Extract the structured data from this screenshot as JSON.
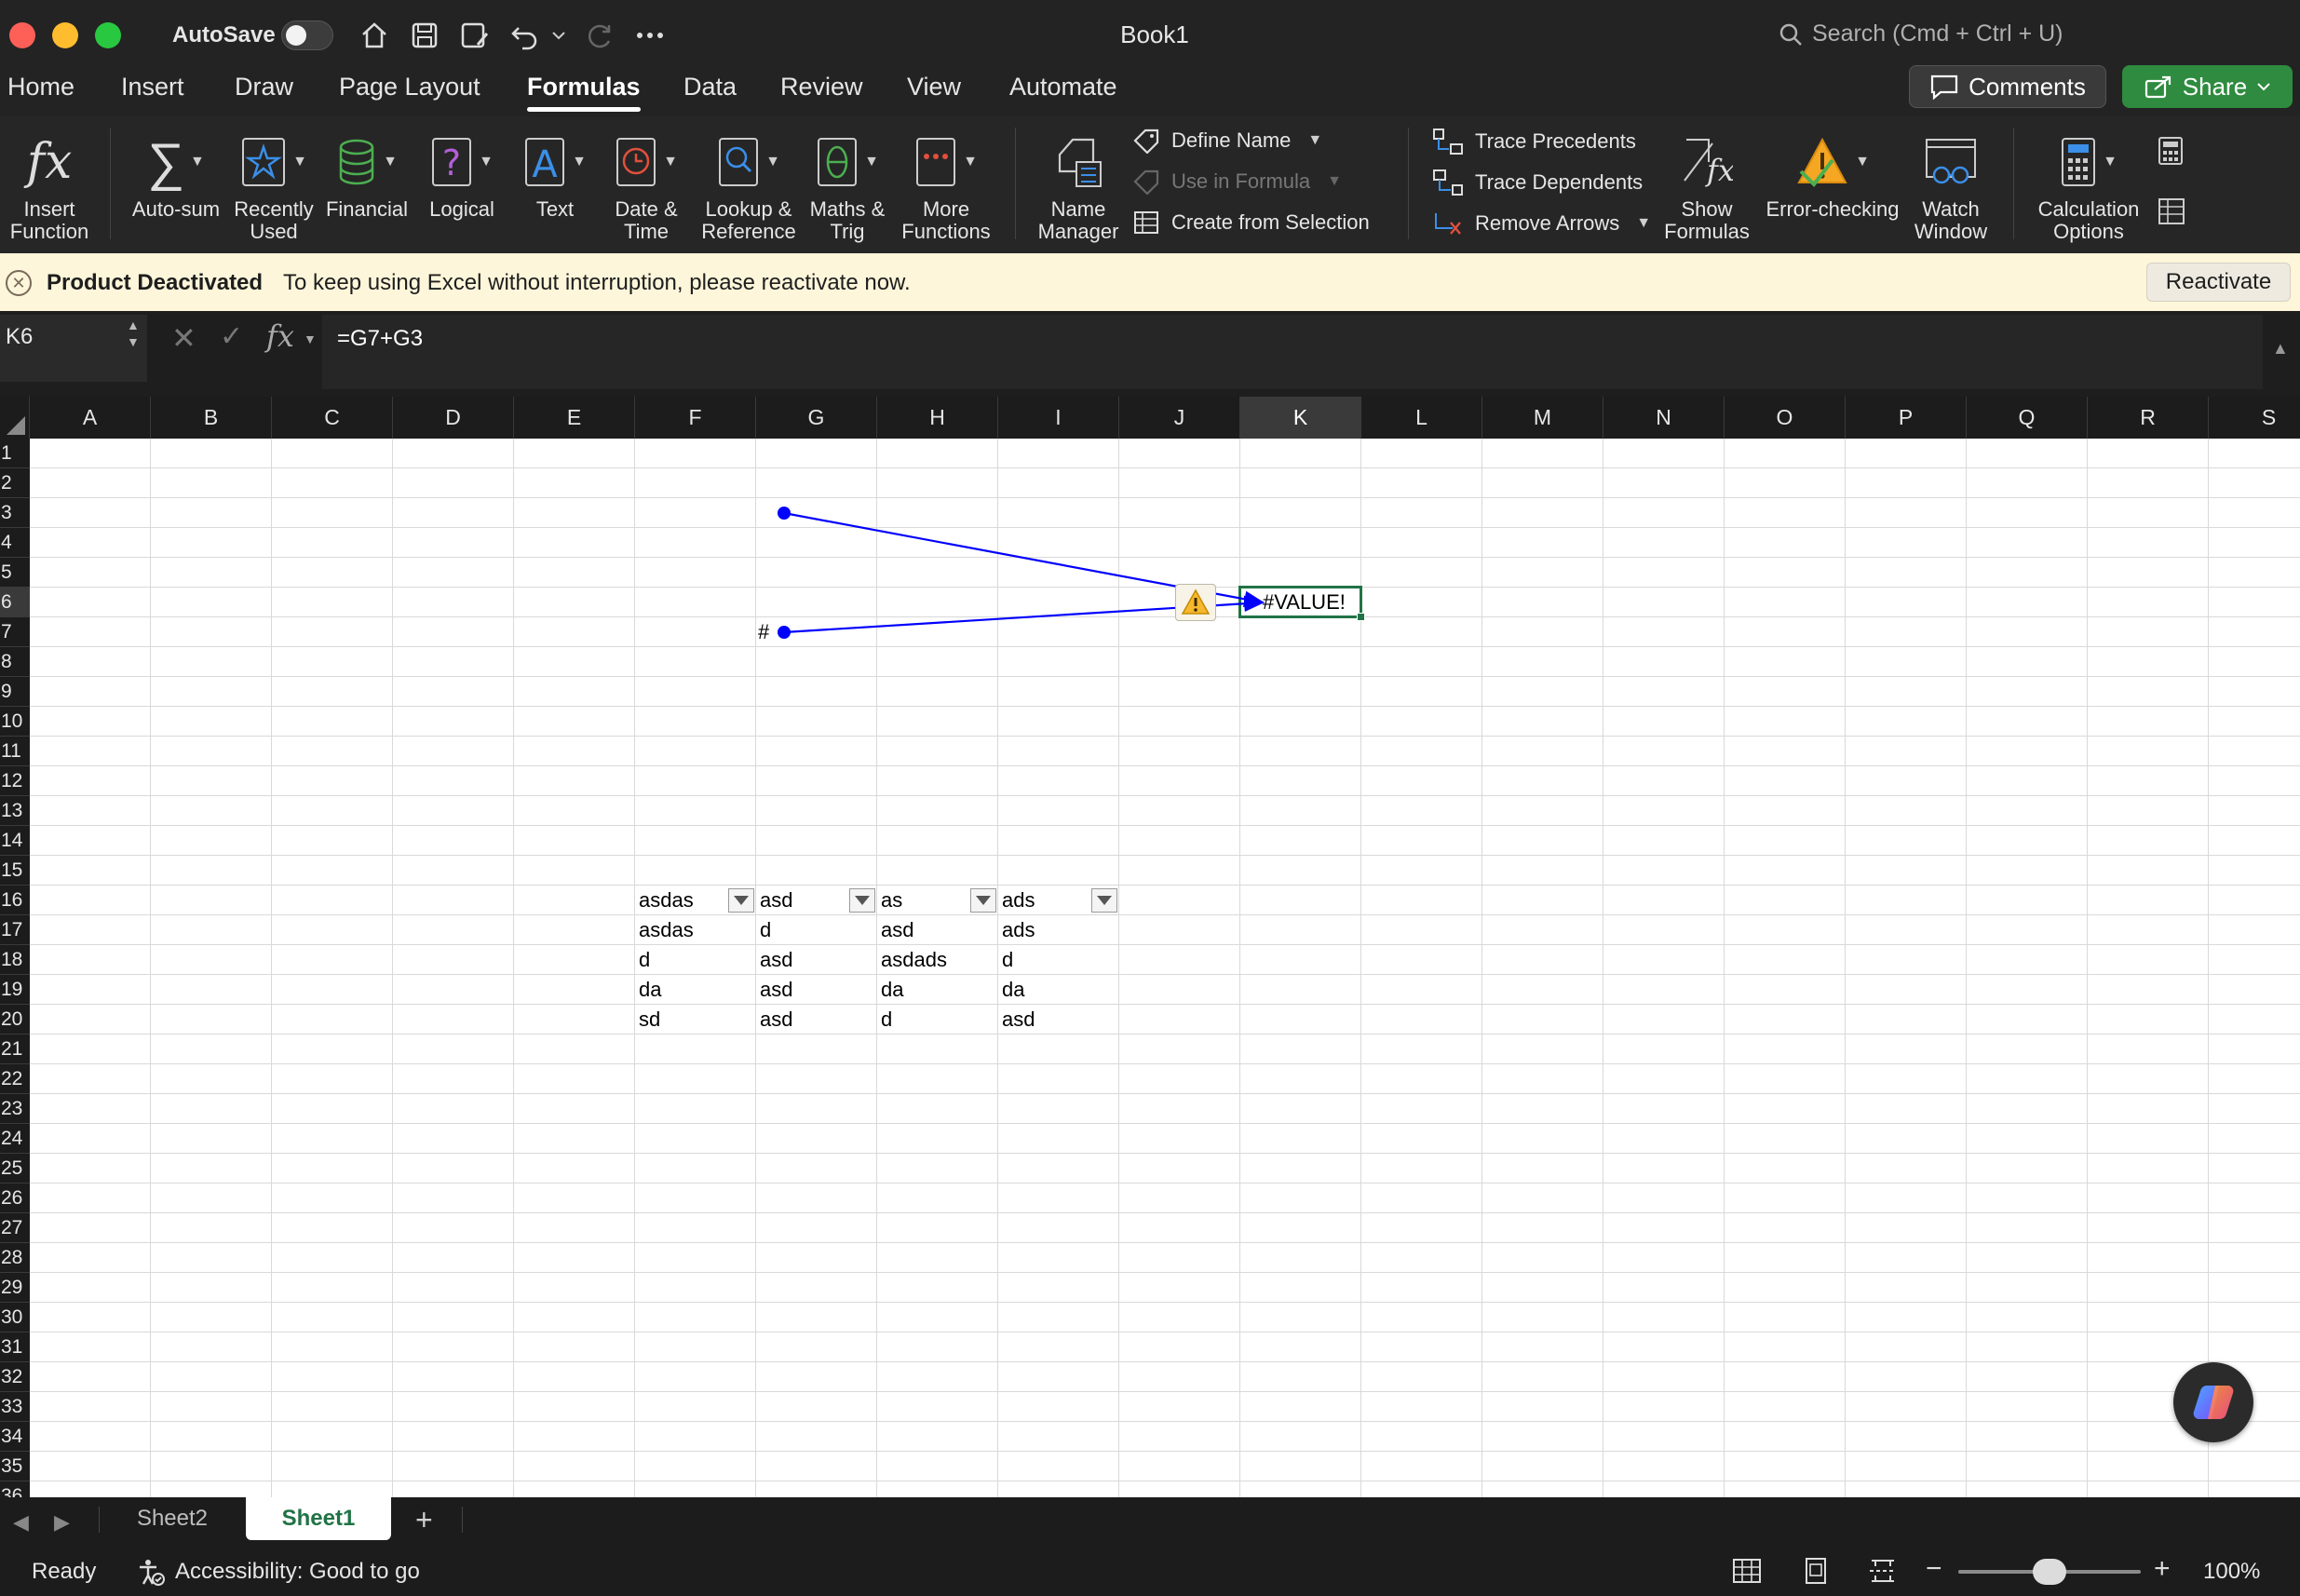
{
  "window": {
    "title": "Book1",
    "autosave_label": "AutoSave",
    "autosave_on": false,
    "search_placeholder": "Search (Cmd + Ctrl + U)"
  },
  "tabs": [
    {
      "label": "Home"
    },
    {
      "label": "Insert"
    },
    {
      "label": "Draw"
    },
    {
      "label": "Page Layout"
    },
    {
      "label": "Formulas",
      "active": true
    },
    {
      "label": "Data"
    },
    {
      "label": "Review"
    },
    {
      "label": "View"
    },
    {
      "label": "Automate"
    }
  ],
  "header_buttons": {
    "comments": "Comments",
    "share": "Share"
  },
  "ribbon": {
    "insert_function": [
      "Insert",
      "Function"
    ],
    "autosum": "Auto-sum",
    "recently_used": [
      "Recently",
      "Used"
    ],
    "financial": "Financial",
    "logical": "Logical",
    "text": "Text",
    "date_time": [
      "Date &",
      "Time"
    ],
    "lookup": [
      "Lookup &",
      "Reference"
    ],
    "maths": [
      "Maths &",
      "Trig"
    ],
    "more_functions": [
      "More",
      "Functions"
    ],
    "name_manager": [
      "Name",
      "Manager"
    ],
    "define_name": "Define Name",
    "use_in_formula": "Use in Formula",
    "create_from_selection": "Create from Selection",
    "trace_precedents": "Trace Precedents",
    "trace_dependents": "Trace Dependents",
    "remove_arrows": "Remove Arrows",
    "show_formulas": [
      "Show",
      "Formulas"
    ],
    "error_checking": "Error-checking",
    "watch_window": [
      "Watch",
      "Window"
    ],
    "calculation_options": [
      "Calculation",
      "Options"
    ]
  },
  "notification": {
    "title": "Product Deactivated",
    "message": "To keep using Excel without interruption, please reactivate now.",
    "button": "Reactivate"
  },
  "formula_bar": {
    "name_box": "K6",
    "formula": "=G7+G3"
  },
  "grid": {
    "columns": [
      "A",
      "B",
      "C",
      "D",
      "E",
      "F",
      "G",
      "H",
      "I",
      "J",
      "K",
      "L",
      "M",
      "N",
      "O",
      "P",
      "Q",
      "R",
      "S"
    ],
    "selected_column": "K",
    "rows": [
      "1",
      "2",
      "3",
      "4",
      "5",
      "6",
      "7",
      "8",
      "9",
      "10",
      "11",
      "12",
      "13",
      "14",
      "15",
      "16",
      "17",
      "18",
      "19",
      "20",
      "21",
      "22",
      "23",
      "24",
      "25",
      "26",
      "27",
      "28",
      "29",
      "30",
      "31",
      "32",
      "33",
      "34",
      "35",
      "36"
    ],
    "selected_row": "6",
    "cells": {
      "K6": "#VALUE!",
      "G7": "#"
    },
    "table": {
      "headers": [
        "asdas",
        "asd",
        "as",
        "ads"
      ],
      "rows": [
        [
          "asdas",
          "d",
          "asd",
          "ads"
        ],
        [
          "d",
          "asd",
          "asdads",
          "d"
        ],
        [
          "da",
          "asd",
          "da",
          "da"
        ],
        [
          "sd",
          "asd",
          "d",
          "asd"
        ]
      ]
    },
    "trace_arrow_color": "#0000ff",
    "selection_color": "#217346"
  },
  "sheets": [
    {
      "name": "Sheet2"
    },
    {
      "name": "Sheet1",
      "active": true
    }
  ],
  "status": {
    "ready": "Ready",
    "accessibility": "Accessibility: Good to go",
    "zoom": "100%",
    "zoom_percent": 100
  }
}
